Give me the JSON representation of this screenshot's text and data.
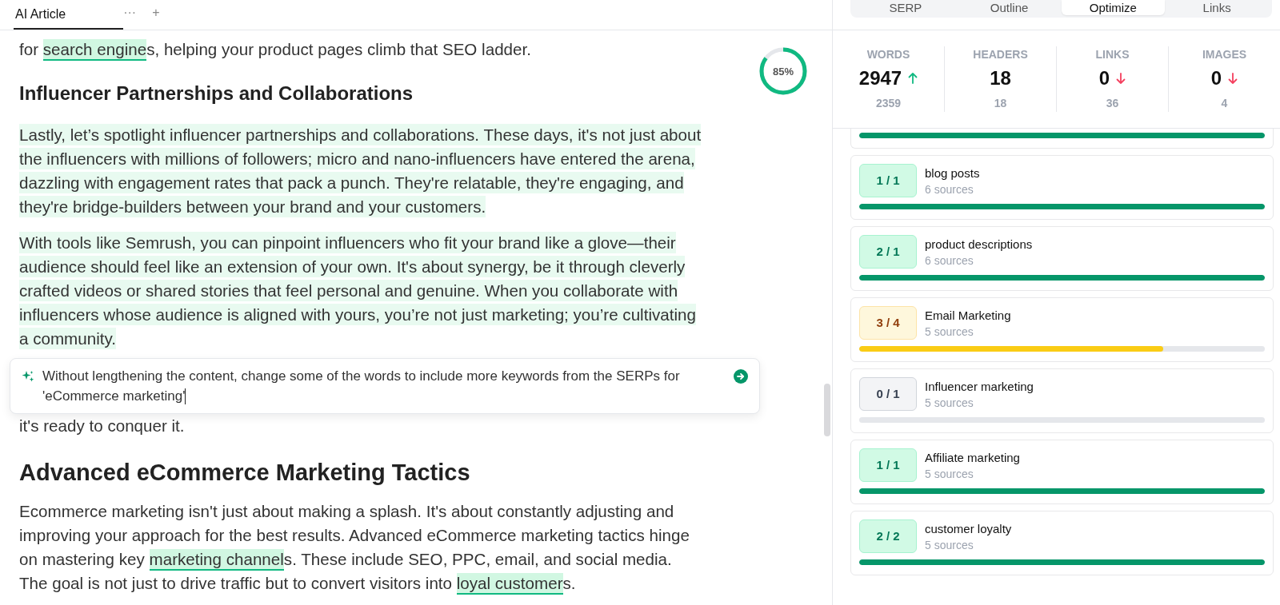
{
  "editor_tabs": [
    {
      "label": "AI Article",
      "selected": true
    }
  ],
  "tab_actions": {
    "more": "···",
    "add": "+"
  },
  "score": {
    "text": "85%",
    "level": 0.85
  },
  "blocks": [
    {
      "kind": "paragraph",
      "highlighted": false,
      "segments": [
        {
          "text": "for ",
          "keyword": false
        },
        {
          "text": "search engine",
          "keyword": true
        },
        {
          "text": "s, helping your product pages climb that SEO ladder.",
          "keyword": false
        }
      ]
    },
    {
      "kind": "heading3",
      "text": "Influencer Partnerships and Collaborations"
    },
    {
      "kind": "paragraph",
      "highlighted": true,
      "segments": [
        {
          "text": "Lastly, let’s spotlight influencer partnerships and collaborations. These days, it's not just about the influencers with millions of followers; micro and nano-influencers have entered the arena, dazzling with engagement rates that pack a punch. They're relatable, they're engaging, and they're bridge-builders between your brand and your customers.",
          "keyword": false
        }
      ]
    },
    {
      "kind": "paragraph",
      "highlighted": true,
      "segments": [
        {
          "text": "With tools like Semrush, you can pinpoint influencers who fit your brand like a glove—their audience should feel like an extension of your own. It's about synergy, be it through cleverly crafted videos or shared stories that feel personal and genuine. When you collaborate with influencers whose audience is aligned with yours, you’re not just marketing; you’re cultivating a community.",
          "keyword": false
        }
      ]
    },
    {
      "kind": "prompt",
      "text": "Without lengthening the content, change some of the words to include more keywords from the SERPs for 'eCommerce marketing'"
    },
    {
      "kind": "paragraph",
      "highlighted": false,
      "segments": [
        {
          "text": "it's ready to conquer it.",
          "keyword": false
        }
      ]
    },
    {
      "kind": "heading2",
      "text": "Advanced eCommerce Marketing Tactics"
    },
    {
      "kind": "paragraph",
      "highlighted": false,
      "segments": [
        {
          "text": "Ecommerce marketing isn't just about making a splash. It's about constantly adjusting and improving your approach for the best results. Advanced eCommerce marketing tactics hinge on mastering key ",
          "keyword": false
        },
        {
          "text": "marketing channel",
          "keyword": true
        },
        {
          "text": "s. These include SEO, PPC, email, and social media. The goal is not just to drive traffic but to convert visitors into ",
          "keyword": false
        },
        {
          "text": "loyal customer",
          "keyword": true
        },
        {
          "text": "s.",
          "keyword": false
        }
      ]
    }
  ],
  "panel_tabs": [
    {
      "label": "SERP",
      "selected": false
    },
    {
      "label": "Outline",
      "selected": false
    },
    {
      "label": "Optimize",
      "selected": true
    },
    {
      "label": "Links",
      "selected": false
    }
  ],
  "stats": [
    {
      "label": "WORDS",
      "value": "2947",
      "up": true,
      "down": false,
      "target": "2359"
    },
    {
      "label": "HEADERS",
      "value": "18",
      "up": false,
      "down": false,
      "target": "18"
    },
    {
      "label": "LINKS",
      "value": "0",
      "up": false,
      "down": true,
      "target": "36"
    },
    {
      "label": "IMAGES",
      "value": "0",
      "up": false,
      "down": true,
      "target": "4"
    }
  ],
  "topics": [
    {
      "level": 1
    },
    {
      "count": "1 / 1",
      "name": "blog posts",
      "sources": "6 sources",
      "level": 1
    },
    {
      "count": "2 / 1",
      "name": "product descriptions",
      "sources": "6 sources",
      "level": 1
    },
    {
      "count": "3 / 4",
      "name": "Email Marketing",
      "sources": "5 sources",
      "level": 0.75
    },
    {
      "count": "0 / 1",
      "name": "Influencer marketing",
      "sources": "5 sources",
      "level": 0
    },
    {
      "count": "1 / 1",
      "name": "Affiliate marketing",
      "sources": "5 sources",
      "level": 1
    },
    {
      "count": "2 / 2",
      "name": "customer loyalty",
      "sources": "5 sources",
      "level": 1
    }
  ]
}
